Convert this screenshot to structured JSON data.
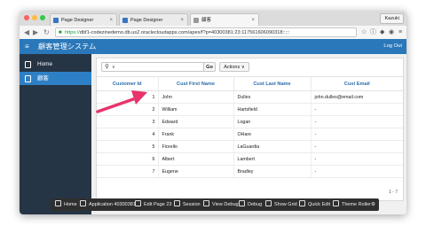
{
  "browser": {
    "tabs": [
      {
        "title": "Page Designer"
      },
      {
        "title": "Page Designer"
      },
      {
        "title": "顧客"
      }
    ],
    "profile": "Kazuki",
    "url_scheme": "https://",
    "url_rest": "dbf1-codezinedemo.db.us2.oraclecloudapps.com/apex/f?p=40300381:23:117561606090318:::::",
    "icons": {
      "back": "◀",
      "forward": "▶",
      "reload": "↻"
    }
  },
  "app": {
    "title": "顧客管理システム",
    "logout_label": "Log Out",
    "accent": "#2a78b9"
  },
  "sidebar": {
    "items": [
      {
        "label": "Home",
        "active": false
      },
      {
        "label": "顧客",
        "active": true
      }
    ]
  },
  "report": {
    "search_placeholder": "",
    "go_label": "Go",
    "actions_label": "Actions ∨",
    "columns": [
      "Customer Id",
      "Cust First Name",
      "Cust Last Name",
      "Cust Email"
    ],
    "rows": [
      [
        "1",
        "John",
        "Dulles",
        "john.dulles@email.com"
      ],
      [
        "2",
        "William",
        "Hartsfield",
        "-"
      ],
      [
        "3",
        "Edward",
        "Logan",
        "-"
      ],
      [
        "4",
        "Frank",
        "OHare",
        "-"
      ],
      [
        "5",
        "Fiorello",
        "LaGuardia",
        "-"
      ],
      [
        "6",
        "Albert",
        "Lambert",
        "-"
      ],
      [
        "7",
        "Eugene",
        "Bradley",
        "-"
      ]
    ],
    "pagination": "1 - 7"
  },
  "devbar": {
    "items": [
      "Home",
      "Application 40300381",
      "Edit Page 23",
      "Session",
      "View Debug",
      "Debug",
      "Show Grid",
      "Quick Edit",
      "Theme Roller"
    ]
  }
}
